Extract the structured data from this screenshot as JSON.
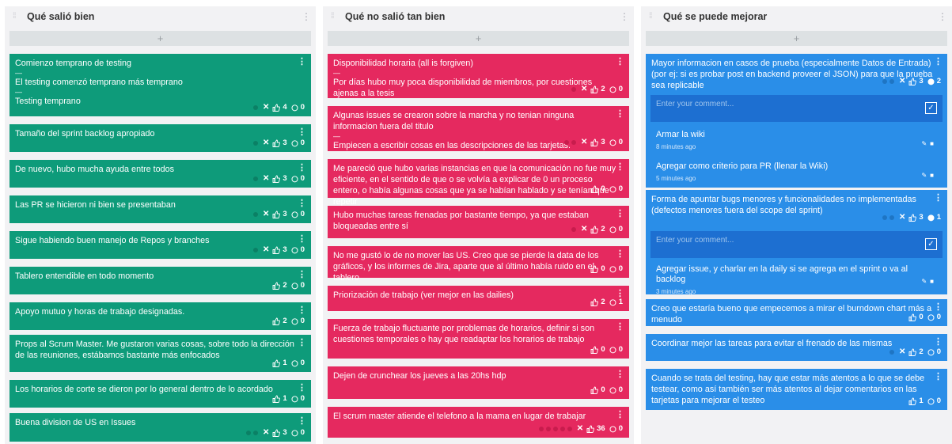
{
  "columns": [
    {
      "title": "Qué salió bien",
      "add_label": "+",
      "cards": [
        {
          "lines": [
            "Comienzo temprano de testing",
            "El testing comenzó temprano más temprano",
            "Testing temprano"
          ],
          "dots": 1,
          "x": true,
          "likes": "4",
          "comments": "0"
        },
        {
          "lines": [
            "Tamaño del sprint backlog apropiado"
          ],
          "dots": 1,
          "x": true,
          "likes": "3",
          "comments": "0"
        },
        {
          "lines": [
            "De nuevo, hubo mucha ayuda entre todos"
          ],
          "dots": 1,
          "x": true,
          "likes": "3",
          "comments": "0"
        },
        {
          "lines": [
            "Las PR se hicieron ni bien se presentaban"
          ],
          "dots": 1,
          "x": true,
          "likes": "3",
          "comments": "0"
        },
        {
          "lines": [
            "Sigue habiendo buen manejo de Repos y branches"
          ],
          "dots": 1,
          "x": true,
          "likes": "3",
          "comments": "0"
        },
        {
          "lines": [
            "Tablero entendible en todo momento"
          ],
          "dots": 0,
          "x": false,
          "likes": "2",
          "comments": "0"
        },
        {
          "lines": [
            "Apoyo mutuo y horas de trabajo designadas."
          ],
          "dots": 0,
          "x": false,
          "likes": "2",
          "comments": "0"
        },
        {
          "lines": [
            "Props al Scrum Master. Me gustaron varias cosas, sobre todo la dirección de las reuniones, estábamos bastante más enfocados"
          ],
          "dots": 0,
          "x": false,
          "likes": "1",
          "comments": "0"
        },
        {
          "lines": [
            "Los horarios de corte se dieron por lo general dentro de lo acordado"
          ],
          "dots": 0,
          "x": false,
          "likes": "1",
          "comments": "0"
        },
        {
          "lines": [
            "Buena division de US en Issues"
          ],
          "dots": 2,
          "x": true,
          "likes": "3",
          "comments": "0"
        }
      ]
    },
    {
      "title": "Qué no salió tan bien",
      "add_label": "+",
      "cards": [
        {
          "lines": [
            "Disponibilidad horaria (all is forgiven)",
            "Por días hubo muy poca disponibilidad de miembros, por cuestiones ajenas a la tesis"
          ],
          "dots": 1,
          "x": true,
          "likes": "2",
          "comments": "0"
        },
        {
          "lines": [
            "Algunas issues se crearon sobre la marcha y no tenian ninguna informacion fuera del titulo",
            "Empiecen a escribir cosas en las descripciones de las tarjetas."
          ],
          "dots": 2,
          "x": true,
          "likes": "3",
          "comments": "0"
        },
        {
          "lines": [
            "Me pareció que hubo varias instancias en que la comunicación no fue muy eficiente, en el sentido de que o se volvía a explicar de 0 un proceso entero, o había algunas cosas que ya se habían hablado y se tenían que repetir"
          ],
          "dots": 0,
          "x": false,
          "likes": "0",
          "comments": "0"
        },
        {
          "lines": [
            "Hubo muchas tareas frenadas por bastante tiempo, ya que estaban bloqueadas entre sí"
          ],
          "dots": 1,
          "x": true,
          "likes": "2",
          "comments": "0"
        },
        {
          "lines": [
            "No me gustó lo de no mover las US. Creo que se pierde la data de los gráficos, y los informes de Jira, aparte que al último había ruido en el tablero"
          ],
          "dots": 0,
          "x": false,
          "likes": "0",
          "comments": "0"
        },
        {
          "lines": [
            "Priorización de trabajo (ver mejor en las dailies)"
          ],
          "dots": 0,
          "x": false,
          "likes": "2",
          "comments": "1"
        },
        {
          "lines": [
            "Fuerza de trabajo fluctuante por problemas de horarios, definir si son cuestiones temporales o hay que readaptar los horarios de trabajo"
          ],
          "dots": 0,
          "x": false,
          "likes": "0",
          "comments": "0"
        },
        {
          "lines": [
            "Dejen de crunchear los jueves a las 20hs hdp"
          ],
          "dots": 0,
          "x": false,
          "likes": "0",
          "comments": "0"
        },
        {
          "lines": [
            "El scrum master atiende el telefono a la mama en lugar de trabajar"
          ],
          "dots": 5,
          "x": true,
          "likes": "36",
          "comments": "0"
        }
      ]
    },
    {
      "title": "Qué se puede mejorar",
      "add_label": "+",
      "cards": [
        {
          "lines": [
            "Mayor informacion en casos de prueba (especialmente Datos de Entrada) (por ej: si es probar post en backend proveer el JSON) para que la prueba sea replicable"
          ],
          "dots": 2,
          "x": true,
          "likes": "3",
          "comments": "2",
          "comment_filled": true
        },
        {
          "lines": [
            "Forma de apuntar bugs menores y funcionalidades no implementadas (defectos menores fuera del scope del sprint)"
          ],
          "dots": 2,
          "x": true,
          "likes": "3",
          "comments": "1",
          "comment_filled": true
        },
        {
          "lines": [
            "Creo que estaría bueno que empecemos a mirar el burndown chart más a menudo"
          ],
          "dots": 0,
          "x": false,
          "likes": "0",
          "comments": "0"
        },
        {
          "lines": [
            "Coordinar mejor las tareas para evitar el frenado de las mismas"
          ],
          "dots": 1,
          "x": true,
          "likes": "2",
          "comments": "0"
        },
        {
          "lines": [
            "Cuando se trata del testing, hay que estar más atentos a lo que se debe testear, como así también ser más atentos al dejar comentarios en las tarjetas para mejorar el testeo"
          ],
          "dots": 0,
          "x": false,
          "likes": "1",
          "comments": "0"
        }
      ],
      "comment_threads": [
        {
          "placeholder": "Enter your comment...",
          "comments": [
            {
              "text": "Armar la wiki",
              "time": "8 minutes ago"
            },
            {
              "text": "Agregar como criterio para PR (llenar la Wiki)",
              "time": "5 minutes ago"
            }
          ]
        },
        {
          "placeholder": "Enter your comment...",
          "comments": [
            {
              "text": "Agregar issue, y charlar en la daily si se agrega en el sprint o va al backlog",
              "time": "3 minutes ago"
            }
          ]
        }
      ]
    }
  ],
  "colors": {
    "green": "#0e9b7a",
    "pink": "#e5295f",
    "blue": "#2a8ee8"
  }
}
